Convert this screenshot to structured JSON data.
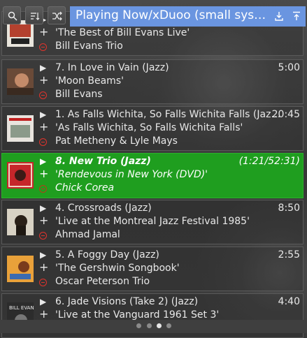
{
  "header": {
    "title": "Playing Now/xDuoo (small sys…",
    "buttons": [
      "search-icon",
      "sort-icon",
      "shuffle-icon"
    ],
    "right_icons": [
      "download-icon",
      "upload-icon"
    ]
  },
  "tracks": [
    {
      "title": "",
      "duration": "",
      "album": "'The Best of Bill Evans Live'",
      "artist": "Bill Evans Trio",
      "art": "bill-evans-live-cover"
    },
    {
      "title": "7. In Love in Vain (Jazz)",
      "duration": "5:00",
      "album": "'Moon Beams'",
      "artist": "Bill Evans",
      "art": "moon-beams-cover"
    },
    {
      "title": "1. As Falls Wichita, So Falls Wichita Falls (Jaz…",
      "duration": "20:45",
      "album": "'As Falls Wichita, So Falls Wichita Falls'",
      "artist": "Pat Metheny & Lyle Mays",
      "art": "wichita-falls-cover"
    },
    {
      "title": "8. New Trio (Jazz)",
      "duration": "(1:21/52:31)",
      "album": "'Rendevous in New York (DVD)'",
      "artist": "Chick Corea",
      "art": "rendezvous-cover",
      "current": true
    },
    {
      "title": "4. Crossroads (Jazz)",
      "duration": "8:50",
      "album": "'Live at the Montreal Jazz Festival 1985'",
      "artist": "Ahmad Jamal",
      "art": "montreal-cover"
    },
    {
      "title": "5. A Foggy Day (Jazz)",
      "duration": "2:55",
      "album": "'The Gershwin Songbook'",
      "artist": "Oscar Peterson Trio",
      "art": "gershwin-cover"
    },
    {
      "title": "6. Jade Visions (Take 2) (Jazz)",
      "duration": "4:40",
      "album": "'Live at the Vanguard 1961 Set 3'",
      "artist": "",
      "art": "vanguard-cover",
      "art_text": "BILL EVANS"
    }
  ],
  "pager": {
    "pages": 4,
    "active": 3
  },
  "colors": {
    "accent": "#6a95e0",
    "current_row": "#1f9e1f",
    "remove": "#e0332c"
  }
}
